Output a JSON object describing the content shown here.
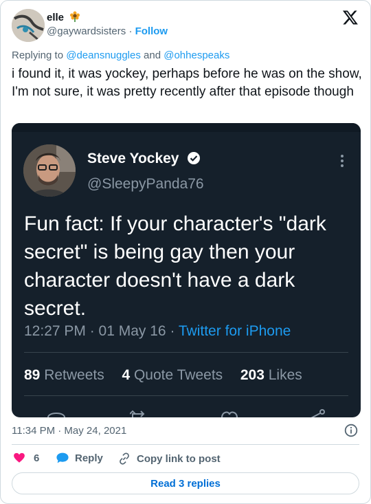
{
  "author": {
    "display_name": "elle",
    "emoji_icon": "sunflower-icon",
    "handle": "@gaywardsisters",
    "separator": "·",
    "follow_label": "Follow"
  },
  "reply_context": {
    "prefix": "Replying to ",
    "mention_1": "@deansnuggles",
    "conjunction": " and ",
    "mention_2": "@ohhespeaks"
  },
  "tweet_text": "i found it, it was yockey, perhaps before he was on the show, I'm not sure, it was pretty recently after that episode though",
  "embedded_screenshot": {
    "display_name": "Steve Yockey",
    "handle": "@SleepyPanda76",
    "text": "Fun fact: If your character's \"dark secret\" is being gay then your character doesn't have a dark secret.",
    "meta_time": "12:27 PM · 01 May 16 · ",
    "meta_source": "Twitter for iPhone",
    "retweets_count": "89",
    "retweets_label": "Retweets",
    "quotes_count": "4",
    "quotes_label": "Quote Tweets",
    "likes_count": "203",
    "likes_label": "Likes",
    "colors": {
      "background": "#15202b",
      "accent": "#1d9bf0",
      "muted": "#8b98a5"
    }
  },
  "timestamp": "11:34 PM · May 24, 2021",
  "actions": {
    "like_count": "6",
    "reply_label": "Reply",
    "copy_link_label": "Copy link to post"
  },
  "read_replies_label": "Read 3 replies",
  "colors": {
    "accent": "#1d9bf0",
    "like": "#f91880",
    "link_button": "#006fd6",
    "muted": "#536471"
  }
}
